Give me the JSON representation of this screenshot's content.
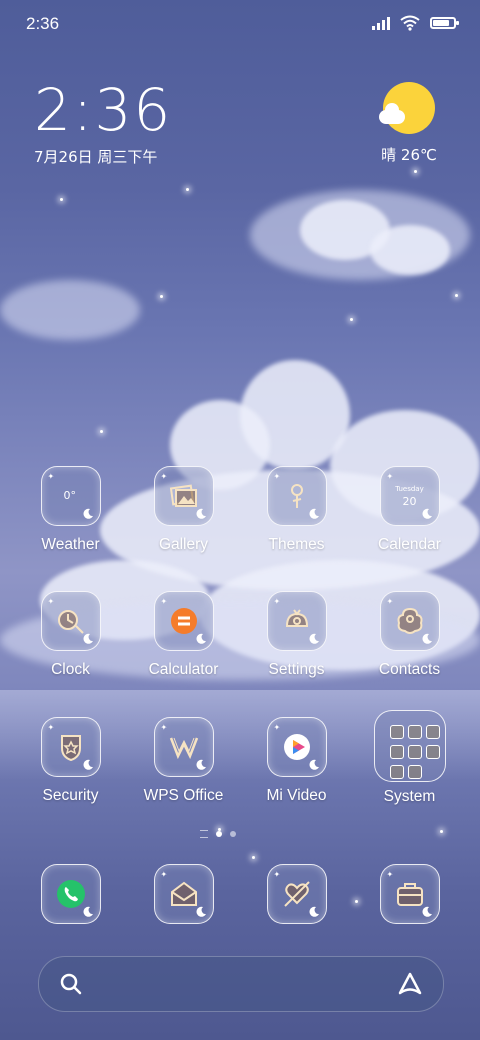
{
  "status_bar": {
    "time": "2:36",
    "icons": [
      "signal-icon",
      "wifi-icon",
      "battery-icon"
    ],
    "battery_level": 0.8
  },
  "clock_widget": {
    "time": "2:36",
    "date": "7月26日 周三下午"
  },
  "weather_widget": {
    "icon": "sun-partly-cloudy-icon",
    "condition": "晴",
    "temperature": "26℃"
  },
  "apps": [
    {
      "label": "Weather",
      "name": "weather",
      "icon": "weather-icon",
      "glyph_text": "0°"
    },
    {
      "label": "Gallery",
      "name": "gallery",
      "icon": "gallery-icon"
    },
    {
      "label": "Themes",
      "name": "themes",
      "icon": "themes-icon"
    },
    {
      "label": "Calendar",
      "name": "calendar",
      "icon": "calendar-icon",
      "glyph_day": "Tuesday",
      "glyph_date": "20"
    },
    {
      "label": "Clock",
      "name": "clock",
      "icon": "clock-icon"
    },
    {
      "label": "Calculator",
      "name": "calculator",
      "icon": "calculator-icon"
    },
    {
      "label": "Settings",
      "name": "settings",
      "icon": "settings-icon"
    },
    {
      "label": "Contacts",
      "name": "contacts",
      "icon": "contacts-icon"
    },
    {
      "label": "Security",
      "name": "security",
      "icon": "security-icon"
    },
    {
      "label": "WPS Office",
      "name": "wps-office",
      "icon": "wps-office-icon"
    },
    {
      "label": "Mi Video",
      "name": "mi-video",
      "icon": "mi-video-icon"
    },
    {
      "label": "System",
      "name": "system-folder",
      "icon": "folder-icon"
    }
  ],
  "page_indicator": {
    "pages": 2,
    "active": 1
  },
  "dock": [
    {
      "name": "phone",
      "icon": "phone-icon"
    },
    {
      "name": "messages",
      "icon": "messages-icon"
    },
    {
      "name": "browser",
      "icon": "heart-arrow-icon"
    },
    {
      "name": "files",
      "icon": "briefcase-icon"
    }
  ],
  "search_bar": {
    "left_icon": "search-icon",
    "right_icon": "assistant-icon"
  },
  "colors": {
    "accent_sun": "#fbd33b",
    "phone_green": "#25c26a",
    "calculator_orange": "#f57c2b"
  }
}
